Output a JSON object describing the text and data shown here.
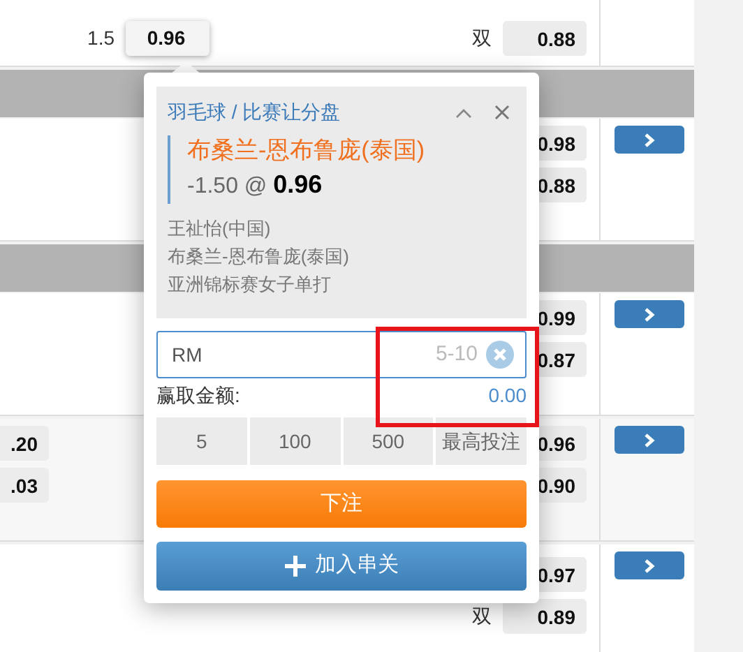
{
  "markets": [
    {
      "kind": "market",
      "col_b": [
        {
          "line": "1.5",
          "value": "0.96",
          "selected": true
        }
      ],
      "col_c": [
        {
          "label": "双",
          "value": "0.88"
        }
      ]
    },
    {
      "kind": "header"
    },
    {
      "kind": "market",
      "more_button": true,
      "col_c": [
        {
          "value": "0.98"
        },
        {
          "value": "0.88"
        }
      ]
    },
    {
      "kind": "header"
    },
    {
      "kind": "market",
      "more_button": true,
      "col_c": [
        {
          "value": "0.99"
        },
        {
          "value": "0.87"
        }
      ]
    },
    {
      "kind": "market",
      "more_button": true,
      "col_a": [
        {
          "value": ".20"
        },
        {
          "value": ".03"
        }
      ],
      "col_c": [
        {
          "value": "0.96"
        },
        {
          "value": "0.90"
        }
      ]
    },
    {
      "kind": "market",
      "more_button": true,
      "col_c": [
        {
          "value": "0.97"
        },
        {
          "label": "双",
          "value": "0.89"
        }
      ]
    }
  ],
  "bet_slip": {
    "breadcrumb": "羽毛球 / 比赛让分盘",
    "selection": "布桑兰-恩布鲁庞(泰国)",
    "handicap": "-1.50 @",
    "odds": "0.96",
    "details": [
      "王祉怡(中国)",
      "布桑兰-恩布鲁庞(泰国)",
      "亚洲锦标赛女子单打"
    ],
    "stake": {
      "prefix": "RM",
      "placeholder": "5-10"
    },
    "highlighted": true,
    "payout_label": "赢取金额:",
    "payout": "0.00",
    "quick_stakes": [
      "5",
      "100",
      "500",
      "最高投注"
    ],
    "place_bet": "下注",
    "add_parlay": "加入串关"
  }
}
